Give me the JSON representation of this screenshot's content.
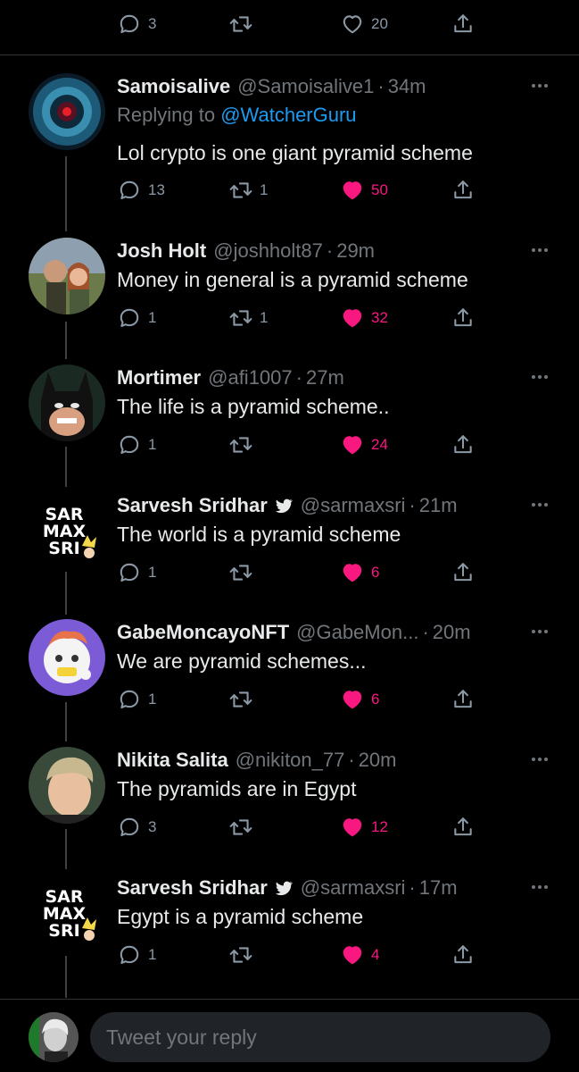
{
  "top_actions": {
    "replies": "3",
    "retweets": "",
    "likes": "20"
  },
  "replying_to_label": "Replying to",
  "replying_to_handle": "@WatcherGuru",
  "tweets": [
    {
      "name": "Samoisalive",
      "handle": "@Samoisalive1",
      "time": "34m",
      "text": "Lol crypto is one giant pyramid scheme",
      "replies": "13",
      "retweets": "1",
      "likes": "50",
      "liked": true,
      "verified": false
    },
    {
      "name": "Josh Holt",
      "handle": "@joshholt87",
      "time": "29m",
      "text": "Money in general is a pyramid scheme",
      "replies": "1",
      "retweets": "1",
      "likes": "32",
      "liked": true,
      "verified": false
    },
    {
      "name": "Mortimer",
      "handle": "@afi1007",
      "time": "27m",
      "text": "The life is a pyramid scheme..",
      "replies": "1",
      "retweets": "",
      "likes": "24",
      "liked": true,
      "verified": false
    },
    {
      "name": "Sarvesh Sridhar",
      "handle": "@sarmaxsri",
      "time": "21m",
      "text": "The world is a pyramid scheme",
      "replies": "1",
      "retweets": "",
      "likes": "6",
      "liked": true,
      "verified": true
    },
    {
      "name": "GabeMoncayoNFT",
      "handle": "@GabeMon...",
      "time": "20m",
      "text": "We are pyramid schemes...",
      "replies": "1",
      "retweets": "",
      "likes": "6",
      "liked": true,
      "verified": false
    },
    {
      "name": "Nikita Salita",
      "handle": "@nikiton_77",
      "time": "20m",
      "text": "The pyramids are in Egypt",
      "replies": "3",
      "retweets": "",
      "likes": "12",
      "liked": true,
      "verified": false
    },
    {
      "name": "Sarvesh Sridhar",
      "handle": "@sarmaxsri",
      "time": "17m",
      "text": "Egypt is a pyramid scheme",
      "replies": "1",
      "retweets": "",
      "likes": "4",
      "liked": true,
      "verified": true
    }
  ],
  "avatar_text": {
    "line1": "SAR",
    "line2": "MAX",
    "line3": "SRI"
  },
  "reply_box": {
    "placeholder": "Tweet your reply"
  },
  "colors": {
    "accent": "#1d9bf0",
    "like": "#f91880",
    "muted": "#71767b",
    "background": "#000000"
  }
}
